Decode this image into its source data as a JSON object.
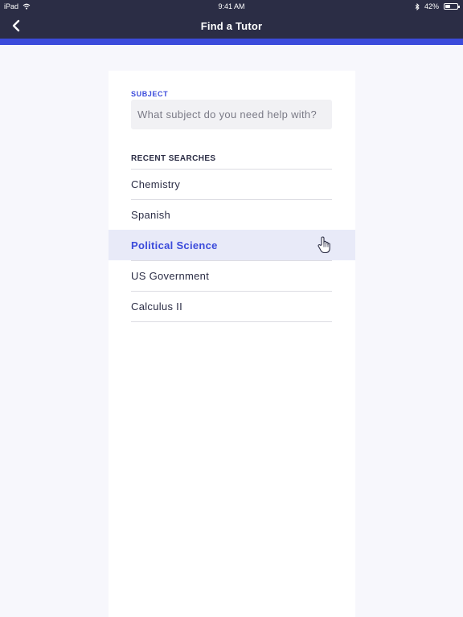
{
  "status": {
    "device": "iPad",
    "time": "9:41 AM",
    "battery": "42%",
    "battery_level": 0.42
  },
  "nav": {
    "title": "Find a Tutor"
  },
  "search": {
    "label": "SUBJECT",
    "placeholder": "What subject do you need help with?"
  },
  "recent": {
    "label": "RECENT SEARCHES",
    "items": [
      {
        "label": "Chemistry",
        "selected": false
      },
      {
        "label": "Spanish",
        "selected": false
      },
      {
        "label": "Political Science",
        "selected": true
      },
      {
        "label": "US Government",
        "selected": false
      },
      {
        "label": "Calculus II",
        "selected": false
      }
    ]
  },
  "colors": {
    "nav_bg": "#2b2d45",
    "accent": "#3b4bdb",
    "selected_bg": "#e8eaf8"
  },
  "icons": [
    "wifi-icon",
    "bluetooth-icon",
    "battery-icon",
    "back-chevron-icon",
    "hand-cursor-icon"
  ]
}
